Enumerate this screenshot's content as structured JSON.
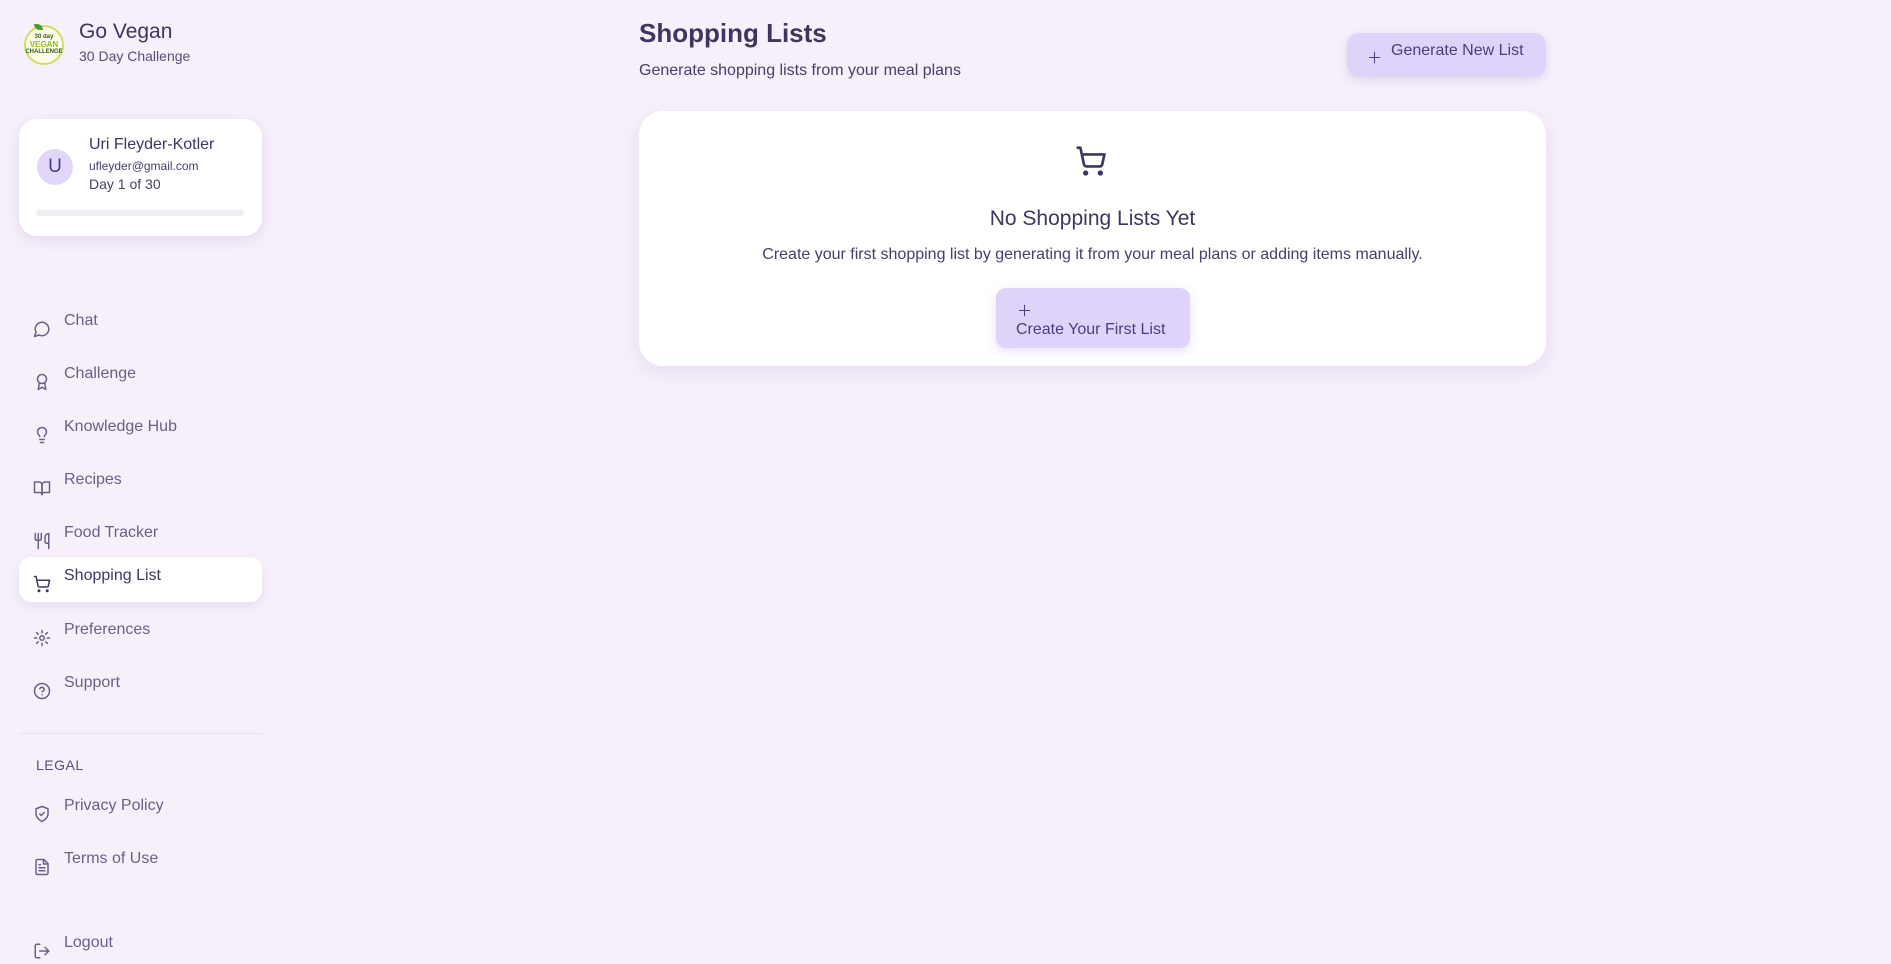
{
  "brand": {
    "title": "Go Vegan",
    "subtitle": "30 Day Challenge",
    "logo_text_top": "30 day",
    "logo_text_mid": "VEGAN",
    "logo_text_bottom": "CHALLENGE"
  },
  "user": {
    "initial": "U",
    "name": "Uri Fleyder-Kotler",
    "email": "ufleyder@gmail.com",
    "day": "Day 1 of 30",
    "progress_fraction": 0
  },
  "nav": {
    "items": [
      {
        "label": "Chat",
        "icon": "chat-bubble-icon"
      },
      {
        "label": "Challenge",
        "icon": "award-icon"
      },
      {
        "label": "Knowledge Hub",
        "icon": "lightbulb-icon"
      },
      {
        "label": "Recipes",
        "icon": "book-icon"
      },
      {
        "label": "Food Tracker",
        "icon": "utensils-icon"
      },
      {
        "label": "Shopping List",
        "icon": "cart-icon",
        "active": true
      },
      {
        "label": "Preferences",
        "icon": "gear-icon"
      },
      {
        "label": "Support",
        "icon": "help-circle-icon"
      }
    ],
    "legal_label": "LEGAL",
    "legal_items": [
      {
        "label": "Privacy Policy",
        "icon": "shield-check-icon"
      },
      {
        "label": "Terms of Use",
        "icon": "document-icon"
      }
    ],
    "logout_label": "Logout"
  },
  "main": {
    "title": "Shopping Lists",
    "subtitle": "Generate shopping lists from your meal plans",
    "generate_button": "Generate New List",
    "empty": {
      "title": "No Shopping Lists Yet",
      "description": "Create your first shopping list by generating it from your meal plans or adding items manually.",
      "button": "Create Your First List"
    }
  },
  "colors": {
    "background": "#f7f0fa",
    "accent_button": "#e0d3fa",
    "text_primary": "#3f3560",
    "nav_text": "#6b5f88"
  }
}
